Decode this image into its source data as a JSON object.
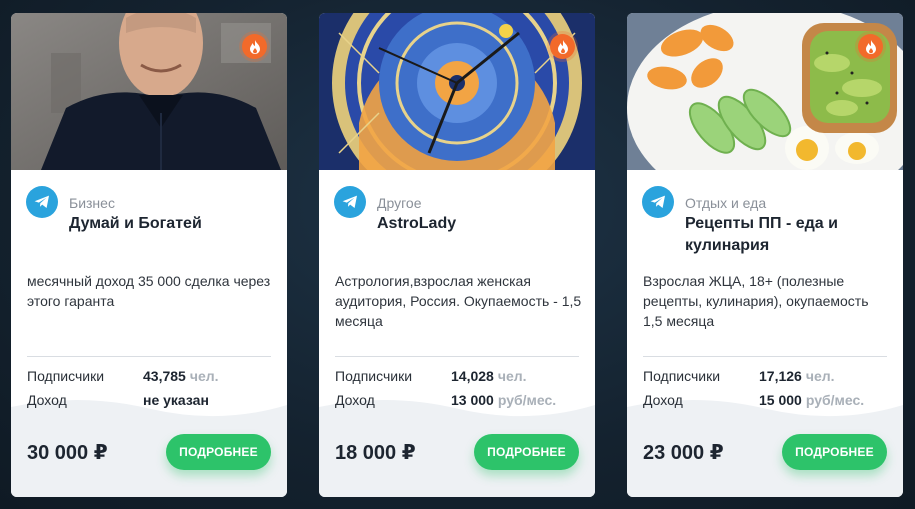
{
  "cards": [
    {
      "category": "Бизнес",
      "title": "Думай и Богатей",
      "description": "месячный доход 35 000 сделка через этого гаранта",
      "stats": [
        {
          "label": "Подписчики",
          "value": "43,785",
          "unit": "чел."
        },
        {
          "label": "Доход",
          "value": "не указан",
          "unit": ""
        }
      ],
      "price": "30 000 ₽",
      "button_label": "ПОДРОБНЕЕ",
      "image": "man-in-dark-shirt-photo"
    },
    {
      "category": "Другое",
      "title": "AstroLady",
      "description": "Астрология,взрослая женская аудитория, Россия. Окупаемость - 1,5 месяца",
      "stats": [
        {
          "label": "Подписчики",
          "value": "14,028",
          "unit": "чел."
        },
        {
          "label": "Доход",
          "value": "13 000",
          "unit": "руб/мес."
        }
      ],
      "price": "18 000 ₽",
      "button_label": "ПОДРОБНЕЕ",
      "image": "astronomical-clock-photo"
    },
    {
      "category": "Отдых и еда",
      "title": " Рецепты ПП - еда и кулинария",
      "description": "Взрослая ЖЦА, 18+ (полезные рецепты, кулинария), окупаемость 1,5 месяца",
      "stats": [
        {
          "label": "Подписчики",
          "value": "17,126",
          "unit": "чел."
        },
        {
          "label": "Доход",
          "value": "15 000",
          "unit": "руб/мес."
        }
      ],
      "price": "23 000 ₽",
      "button_label": "ПОДРОБНЕЕ",
      "image": "healthy-breakfast-plate-photo"
    }
  ],
  "icons": {
    "hot": "fire-icon",
    "messenger": "telegram-icon"
  },
  "colors": {
    "accent_green": "#2dc36a",
    "telegram_blue": "#2aa3dd",
    "hot_orange": "#f26a2a",
    "background": "#14222f"
  }
}
